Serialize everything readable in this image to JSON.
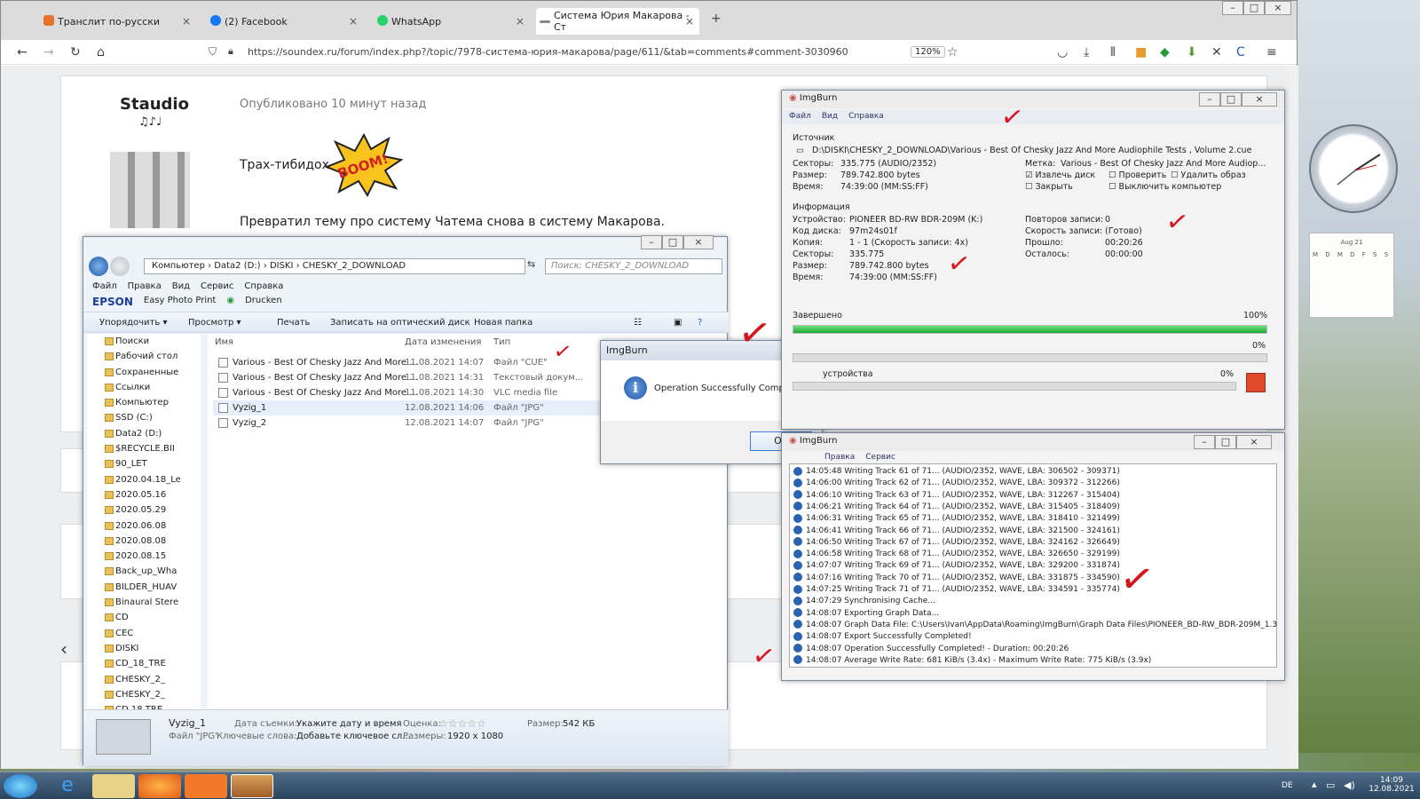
{
  "browser": {
    "tabs": [
      {
        "label": "Транслит по-русски",
        "favicon": "#e8722d"
      },
      {
        "label": "(2) Facebook",
        "favicon": "#1877f2"
      },
      {
        "label": "WhatsApp",
        "favicon": "#25d366"
      },
      {
        "label": "Система Юрия Макарова - Ст",
        "favicon": "#888888"
      }
    ],
    "url": "https://soundex.ru/forum/index.php?/topic/7978-система-юрия-макарова/page/611/&tab=comments#comment-3030960",
    "zoom": "120%"
  },
  "post": {
    "username": "Staudio",
    "notes": "♫♪♩",
    "posted": "Опубликовано 10 минут назад",
    "line1": "Трах-тибидох",
    "boom": "BOOM!",
    "line2": "Превратил тему про систему Чатема снова в систему Макарова."
  },
  "explorer": {
    "breadcrumb": "Компьютер  ›  Data2 (D:)  ›  DISKI  ›  CHESKY_2_DOWNLOAD",
    "search_placeholder": "Поиск: CHESKY_2_DOWNLOAD",
    "menu": [
      "Файл",
      "Правка",
      "Вид",
      "Сервис",
      "Справка"
    ],
    "epson": "EPSON",
    "epson_app": "Easy Photo Print",
    "drucken": "Drucken",
    "toolbar": [
      "Упорядочить ▾",
      "Просмотр ▾",
      "Печать",
      "Записать на оптический диск",
      "Новая папка"
    ],
    "tree": [
      "Поиски",
      "Рабочий стол",
      "Сохраненные",
      "Ссылки",
      "Компьютер",
      "SSD (C:)",
      "Data2 (D:)",
      "$RECYCLE.BII",
      "90_LET",
      "2020.04.18_Le",
      "2020.05.16",
      "2020.05.29",
      "2020.06.08",
      "2020.08.08",
      "2020.08.15",
      "Back_up_Wha",
      "BILDER_HUAV",
      "Binaural Stere",
      "CD",
      "CEC",
      "DISKI",
      "CD_18_TRE",
      "CHESKY_2_",
      "CHESKY_2_",
      "CD 18 TRE"
    ],
    "columns": [
      "Имя",
      "Дата изменения",
      "Тип"
    ],
    "files": [
      {
        "name": "Various - Best Of Chesky Jazz And More ...",
        "date": "11.08.2021 14:07",
        "type": "Файл \"CUE\""
      },
      {
        "name": "Various - Best Of Chesky Jazz And More ...",
        "date": "11.08.2021 14:31",
        "type": "Текстовый докум..."
      },
      {
        "name": "Various - Best Of Chesky Jazz And More ...",
        "date": "11.08.2021 14:30",
        "type": "VLC media file"
      },
      {
        "name": "Vyzig_1",
        "date": "12.08.2021 14:06",
        "type": "Файл \"JPG\""
      },
      {
        "name": "Vyzig_2",
        "date": "12.08.2021 14:07",
        "type": "Файл \"JPG\""
      }
    ],
    "status": {
      "name": "Vyzig_1",
      "kind": "Файл \"JPG\"",
      "date_label": "Дата съемки:",
      "date_value": "Укажите дату и время",
      "rating_label": "Оценка:",
      "stars": "☆☆☆☆☆",
      "keywords_label": "Ключевые слова:",
      "keywords_value": "Добавьте ключевое сл...",
      "dims_label": "Размеры:",
      "dims_value": "1920 x 1080",
      "size_label": "Размер:",
      "size_value": "542 КБ"
    }
  },
  "dialog": {
    "title": "ImgBurn",
    "message": "Operation Successfully Completed!",
    "ok": "OK"
  },
  "imgburn": {
    "title": "ImgBurn",
    "menu": [
      "Файл",
      "Вид",
      "Справка"
    ],
    "source_label": "Источник",
    "source_path": "D:\\DISKI\\CHESKY_2_DOWNLOAD\\Various - Best Of Chesky Jazz And More Audiophile Tests , Volume 2.cue",
    "sectors_label": "Секторы:",
    "sectors_value": "335.775 (AUDIO/2352)",
    "size_label": "Размер:",
    "size_value": "789.742.800 bytes",
    "time_label": "Время:",
    "time_value": "74:39:00 (MM:SS:FF)",
    "mark_label": "Метка:",
    "mark_value": "Various - Best Of Chesky Jazz And More Audiop...",
    "chk_eject": "Извлечь диск",
    "chk_verify": "Проверить",
    "chk_delete": "Удалить образ",
    "chk_close": "Закрыть",
    "chk_shutdown": "Выключить компьютер",
    "info_label": "Информация",
    "device_label": "Устройство:",
    "device_value": "PIONEER BD-RW BDR-209M (K:)",
    "disc_label": "Код диска:",
    "disc_value": "97m24s01f",
    "copy_label": "Копия:",
    "copy_value": "1 - 1 (Скорость записи: 4x)",
    "sectors2_value": "335.775",
    "size2_value": "789.742.800 bytes",
    "time2_value": "74:39:00 (MM:SS:FF)",
    "retries_label": "Повторов записи:",
    "retries_value": "0",
    "speed_label": "Скорость записи:",
    "speed_value": "(Готово)",
    "elapsed_label": "Прошло:",
    "elapsed_value": "00:20:26",
    "remain_label": "Осталось:",
    "remain_value": "00:00:00",
    "done_label": "Завершено",
    "done_pct": "100%",
    "buf_pct": "0%",
    "dev_label": "устройства",
    "dev_pct": "0%",
    "progress_complete": 1.0
  },
  "imgburn_log": {
    "title": "ImgBurn",
    "menu": [
      "Правка",
      "Сервис"
    ],
    "lines": [
      "14:05:48 Writing Track 61 of 71... (AUDIO/2352, WAVE, LBA: 306502 - 309371)",
      "14:06:00 Writing Track 62 of 71... (AUDIO/2352, WAVE, LBA: 309372 - 312266)",
      "14:06:10 Writing Track 63 of 71... (AUDIO/2352, WAVE, LBA: 312267 - 315404)",
      "14:06:21 Writing Track 64 of 71... (AUDIO/2352, WAVE, LBA: 315405 - 318409)",
      "14:06:31 Writing Track 65 of 71... (AUDIO/2352, WAVE, LBA: 318410 - 321499)",
      "14:06:41 Writing Track 66 of 71... (AUDIO/2352, WAVE, LBA: 321500 - 324161)",
      "14:06:50 Writing Track 67 of 71... (AUDIO/2352, WAVE, LBA: 324162 - 326649)",
      "14:06:58 Writing Track 68 of 71... (AUDIO/2352, WAVE, LBA: 326650 - 329199)",
      "14:07:07 Writing Track 69 of 71... (AUDIO/2352, WAVE, LBA: 329200 - 331874)",
      "14:07:16 Writing Track 70 of 71... (AUDIO/2352, WAVE, LBA: 331875 - 334590)",
      "14:07:25 Writing Track 71 of 71... (AUDIO/2352, WAVE, LBA: 334591 - 335774)",
      "14:07:29 Synchronising Cache...",
      "14:08:07 Exporting Graph Data...",
      "14:08:07 Graph Data File: C:\\Users\\Ivan\\AppData\\Roaming\\ImgBurn\\Graph Data Files\\PIONEER_BD-RW_BDR-209M_1.3",
      "14:08:07 Export Successfully Completed!",
      "14:08:07 Operation Successfully Completed! - Duration: 00:20:26",
      "14:08:07 Average Write Rate: 681 KiB/s (3.4x) - Maximum Write Rate: 775 KiB/s (3.9x)"
    ]
  },
  "calendar": {
    "month": "Aug 21",
    "days": "M D M D F S S"
  },
  "taskbar": {
    "lang": "DE",
    "time": "14:09",
    "date": "12.08.2021"
  }
}
